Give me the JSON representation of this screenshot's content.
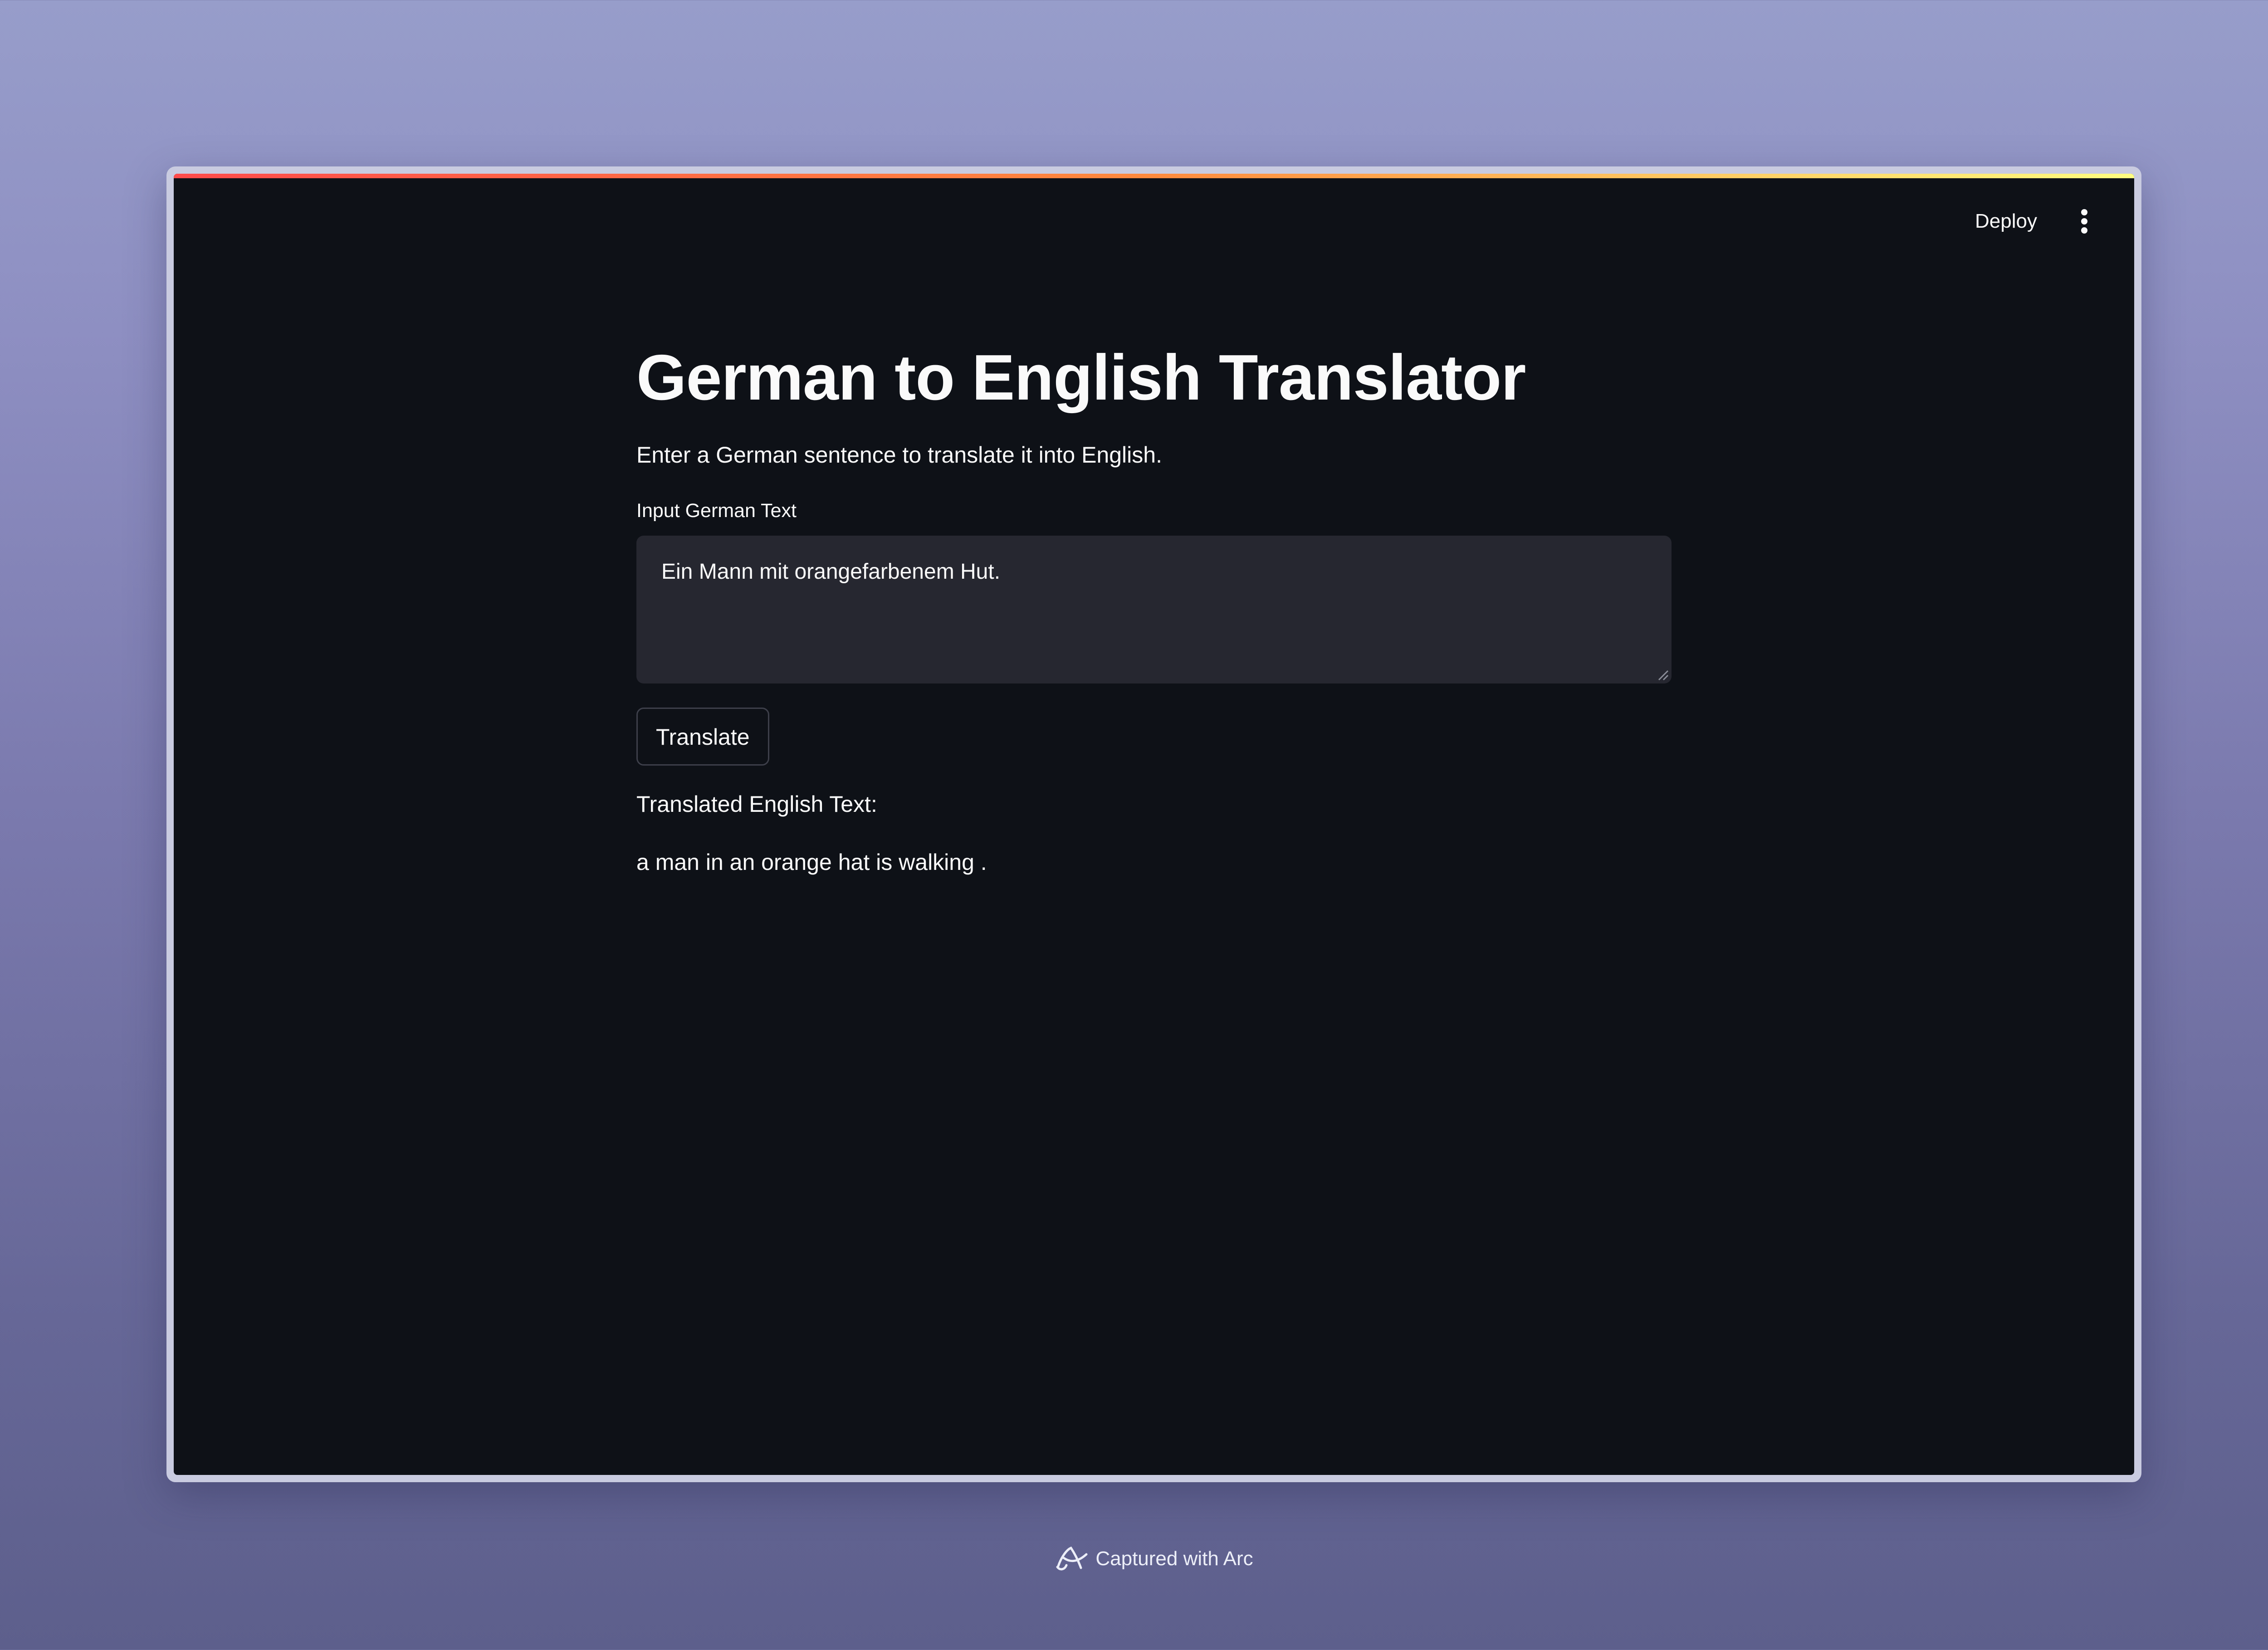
{
  "header": {
    "deploy_label": "Deploy",
    "menu_icon": "more-vertical-icon"
  },
  "main": {
    "title": "German to English Translator",
    "subtitle": "Enter a German sentence to translate it into English.",
    "input_label": "Input German Text",
    "input_value": "Ein Mann mit orangefarbenem Hut.",
    "translate_label": "Translate",
    "result_label": "Translated English Text:",
    "result_text": "a man in an orange hat is walking ."
  },
  "footer": {
    "caption": "Captured with Arc",
    "icon": "arc-logo-icon"
  },
  "colors": {
    "app_background": "#0e1117",
    "input_background": "#262730",
    "text": "#fafafa",
    "accent_red": "#ff4b4b",
    "accent_yellow": "#fffd80"
  }
}
